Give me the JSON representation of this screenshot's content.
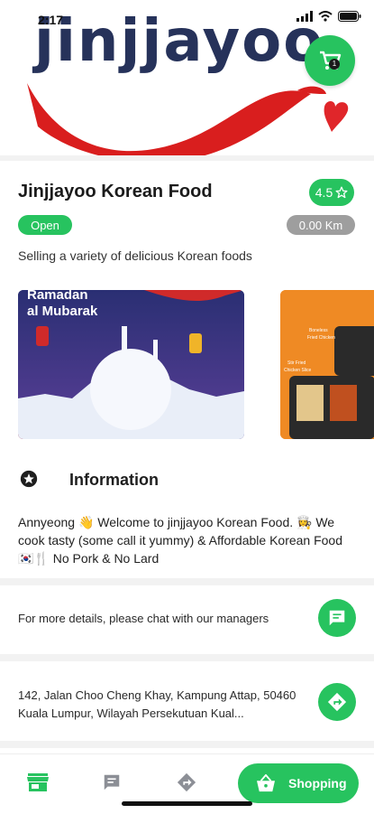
{
  "status_bar": {
    "time": "2:17"
  },
  "header": {
    "logo_text": "jinjjayoo",
    "cart_count": "1"
  },
  "store": {
    "name": "Jinjjayoo Korean Food",
    "rating": "4.5",
    "status": "Open",
    "distance": "0.00 Km",
    "description": "Selling a variety of delicious Korean foods"
  },
  "banners": [
    {
      "text_line1": "Ramadan",
      "text_line2": "al Mubarak"
    },
    {
      "text_line1": "Boneless",
      "text_line2": "Fried Chicken",
      "text_line3": "Stir Fried",
      "text_line4": "Chicken Slice"
    }
  ],
  "information": {
    "title": "Information",
    "body": "Annyeong 👋 Welcome to jinjjayoo Korean Food. 👩‍🍳 We cook tasty (some call it yummy) & Affordable Korean Food 🇰🇷🍴 No Pork & No Lard"
  },
  "contact": {
    "chat_text": "For more details, please chat with our managers",
    "address": "142, Jalan Choo Cheng Khay, Kampung Attap, 50460 Kuala Lumpur, Wilayah Persekutuan Kual..."
  },
  "bottom_nav": {
    "shopping_label": "Shopping"
  },
  "colors": {
    "accent": "#27c35f",
    "logo": "#26325a",
    "red": "#d91e1e",
    "grey_pill": "#9e9e9e"
  }
}
